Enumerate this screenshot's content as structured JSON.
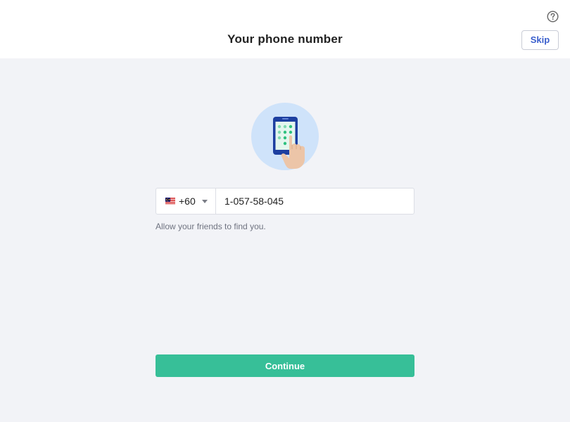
{
  "header": {
    "title": "Your phone number",
    "skip_label": "Skip",
    "help_icon": "question-circle-icon"
  },
  "illustration": {
    "icon": "phone-keypad-illustration"
  },
  "phone": {
    "country_flag": "malaysia-flag-icon",
    "dial_code": "+60",
    "number": "1-057-58-045",
    "helper": "Allow your friends to find you."
  },
  "actions": {
    "continue_label": "Continue"
  },
  "colors": {
    "primary": "#37bf98",
    "link": "#3a5fcd",
    "background": "#f2f3f7"
  }
}
